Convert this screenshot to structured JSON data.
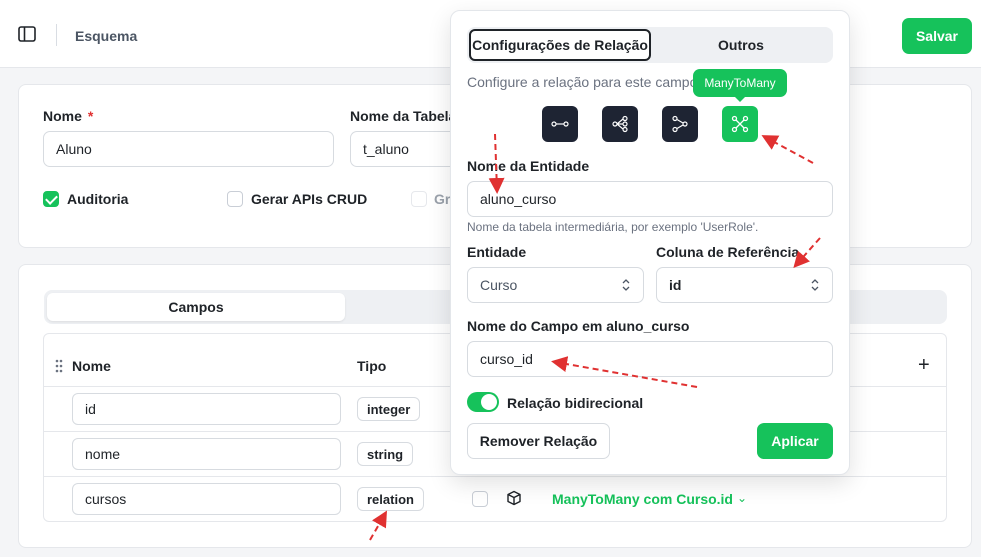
{
  "header": {
    "breadcrumb": "Esquema",
    "save_label": "Salvar"
  },
  "entity_form": {
    "name_label": "Nome",
    "required_mark": "*",
    "name_value": "Aluno",
    "table_label": "Nome da Tabela",
    "table_value": "t_aluno",
    "audit_label": "Auditoria",
    "audit_checked": true,
    "crud_label": "Gerar APIs CRUD",
    "crud_checked": false,
    "third_label_partial": "Gr"
  },
  "fields_tab": {
    "label": "Campos"
  },
  "table": {
    "headers": {
      "name": "Nome",
      "type": "Tipo",
      "add": "+"
    },
    "rows": [
      {
        "name": "id",
        "type": "integer"
      },
      {
        "name": "nome",
        "type": "string"
      },
      {
        "name": "cursos",
        "type": "relation",
        "relation_summary": "ManyToMany com Curso.id"
      }
    ]
  },
  "popover": {
    "tabs": [
      "Configurações de Relação",
      "Outros"
    ],
    "hint": "Configure a relação para este campo",
    "tooltip": "ManyToMany",
    "relation_types": [
      "one-to-one-icon",
      "one-to-many-icon",
      "many-to-one-icon",
      "many-to-many-icon"
    ],
    "entity_name_label": "Nome da Entidade",
    "entity_name_value": "aluno_curso",
    "entity_name_help": "Nome da tabela intermediária, por exemplo 'UserRole'.",
    "entity_label": "Entidade",
    "entity_value": "Curso",
    "ref_column_label": "Coluna de Referência",
    "ref_column_value": "id",
    "field_name_label": "Nome do Campo em aluno_curso",
    "field_name_value": "curso_id",
    "bidirectional_label": "Relação bidirecional",
    "bidirectional_on": true,
    "remove_label": "Remover Relação",
    "apply_label": "Aplicar"
  },
  "colors": {
    "accent": "#16c25b",
    "annotation": "#e03131",
    "dark_button": "#1e2433"
  }
}
